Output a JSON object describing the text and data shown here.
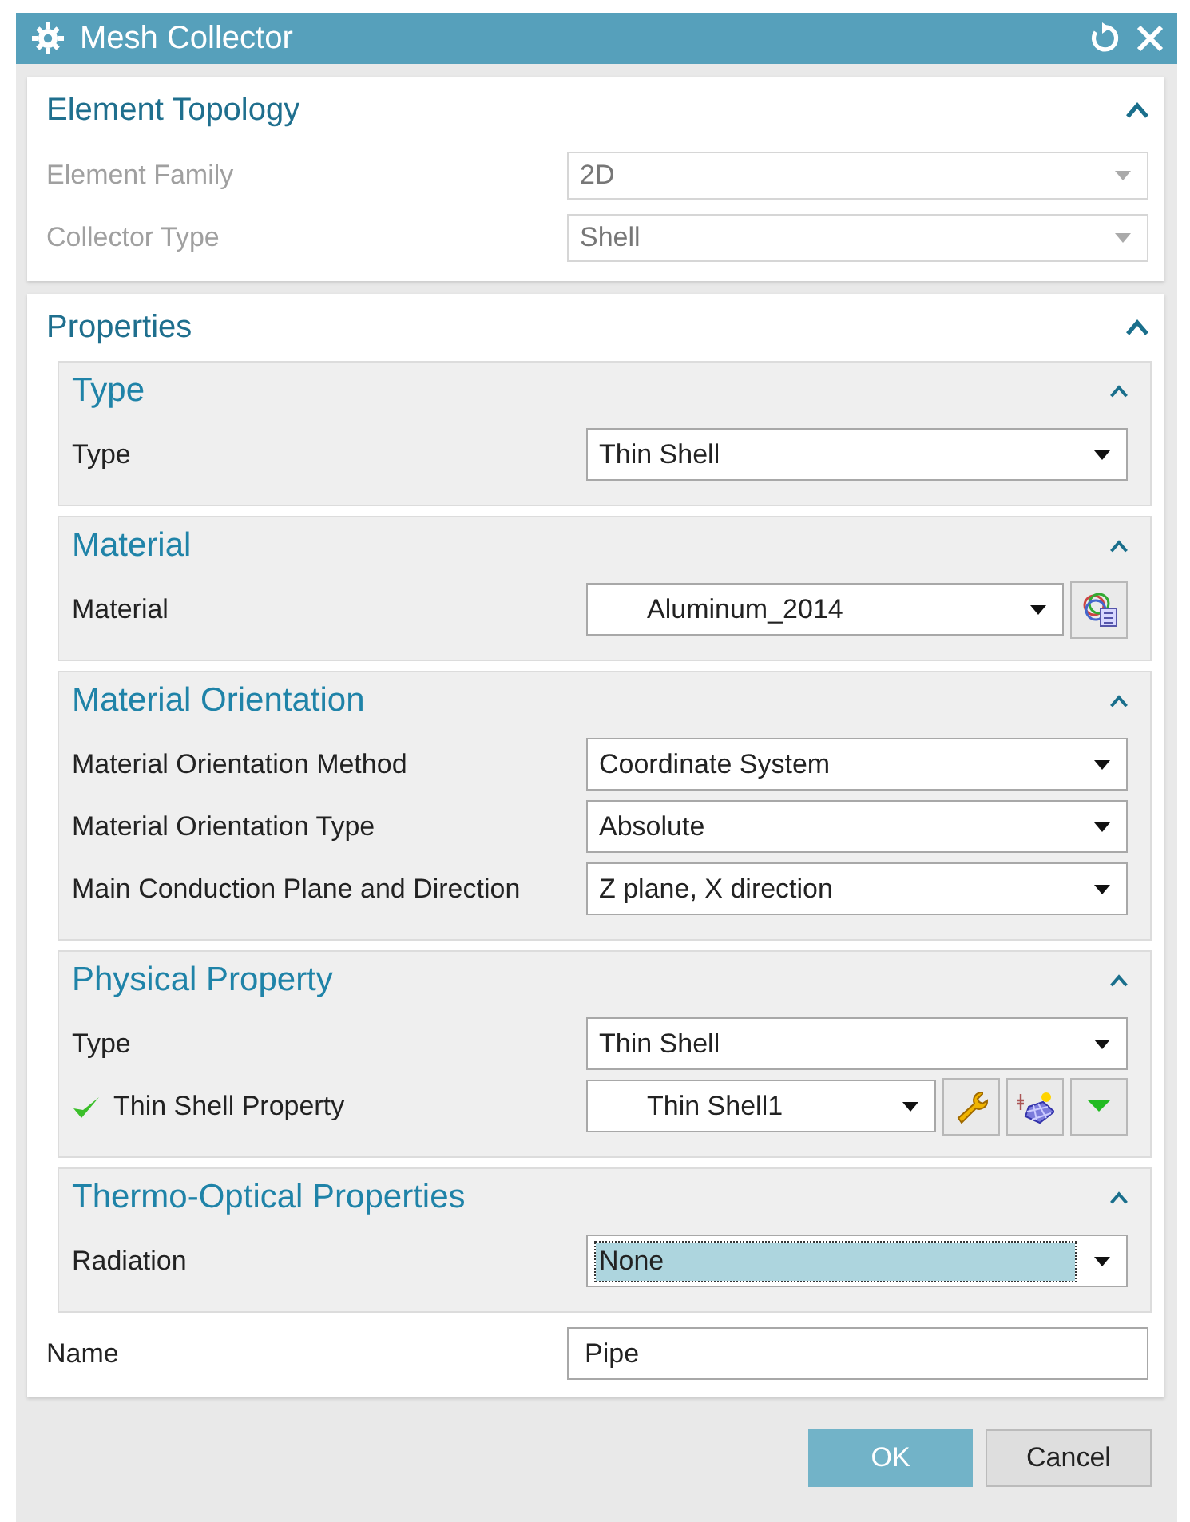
{
  "window": {
    "title": "Mesh Collector"
  },
  "sections": [
    {
      "title": "Element Topology",
      "expanded": true,
      "rows": [
        {
          "kind": "dropdown",
          "label": "Element Family",
          "value": "2D",
          "disabled": true
        },
        {
          "kind": "dropdown",
          "label": "Collector Type",
          "value": "Shell",
          "disabled": true
        }
      ]
    },
    {
      "title": "Properties",
      "expanded": true,
      "groups": [
        {
          "title": "Type",
          "expanded": true,
          "rows": [
            {
              "kind": "dropdown",
              "label": "Type",
              "value": "Thin Shell",
              "disabled": false
            }
          ]
        },
        {
          "title": "Material",
          "expanded": true,
          "rows": [
            {
              "kind": "tool-dropdown",
              "label": "Material",
              "value": "Aluminum_2014",
              "disabled": false,
              "tools": [
                {
                  "kind": "material-library"
                }
              ]
            }
          ]
        },
        {
          "title": "Material Orientation",
          "expanded": true,
          "rows": [
            {
              "kind": "dropdown",
              "label": "Material Orientation Method",
              "value": "Coordinate System",
              "disabled": false
            },
            {
              "kind": "dropdown",
              "label": "Material Orientation Type",
              "value": "Absolute",
              "disabled": false
            },
            {
              "kind": "dropdown",
              "label": "Main Conduction Plane and Direction",
              "value": "Z plane, X direction",
              "disabled": false
            }
          ]
        },
        {
          "title": "Physical Property",
          "expanded": true,
          "rows": [
            {
              "kind": "dropdown",
              "label": "Type",
              "value": "Thin Shell",
              "disabled": false
            },
            {
              "kind": "tool-dropdown",
              "label": "Thin Shell Property",
              "value": "Thin Shell1",
              "disabled": false,
              "valid": true,
              "tools": [
                {
                  "kind": "wrench"
                },
                {
                  "kind": "mesh"
                },
                {
                  "kind": "more"
                }
              ]
            }
          ]
        },
        {
          "title": "Thermo-Optical Properties",
          "expanded": true,
          "rows": [
            {
              "kind": "dropdown",
              "label": "Radiation",
              "value": "None",
              "disabled": false,
              "focused": true
            }
          ]
        }
      ],
      "rows": [
        {
          "kind": "text",
          "label": "Name",
          "value": "Pipe"
        }
      ]
    }
  ],
  "buttons": [
    {
      "label": "OK",
      "kind": "primary"
    },
    {
      "label": "Cancel",
      "kind": "secondary"
    }
  ]
}
